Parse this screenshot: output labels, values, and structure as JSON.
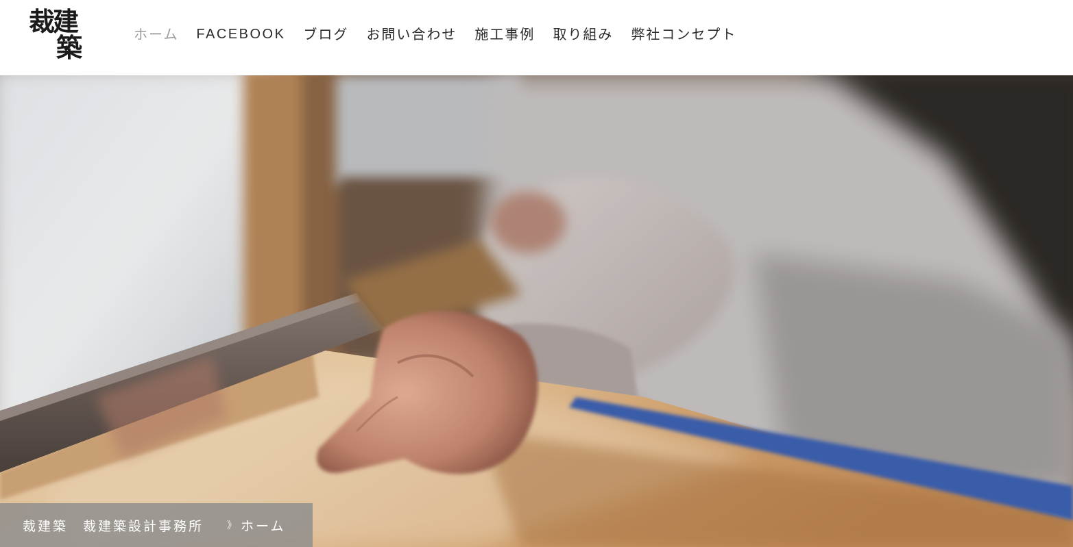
{
  "logo": {
    "line1": "裁建",
    "line2": "築"
  },
  "nav": {
    "items": [
      {
        "label": "ホーム",
        "active": true
      },
      {
        "label": "FACEBOOK",
        "active": false
      },
      {
        "label": "ブログ",
        "active": false
      },
      {
        "label": "お問い合わせ",
        "active": false
      },
      {
        "label": "施工事例",
        "active": false
      },
      {
        "label": "取り組み",
        "active": false
      },
      {
        "label": "弊社コンセプト",
        "active": false
      }
    ]
  },
  "breadcrumb": {
    "site": "裁建築　裁建築設計事務所",
    "separator": "》",
    "current": "ホーム"
  },
  "colors": {
    "nav_text": "#2b2b2b",
    "nav_active": "#9a9a9a",
    "breadcrumb_bg": "#8c8c8c",
    "breadcrumb_text": "#ffffff"
  }
}
